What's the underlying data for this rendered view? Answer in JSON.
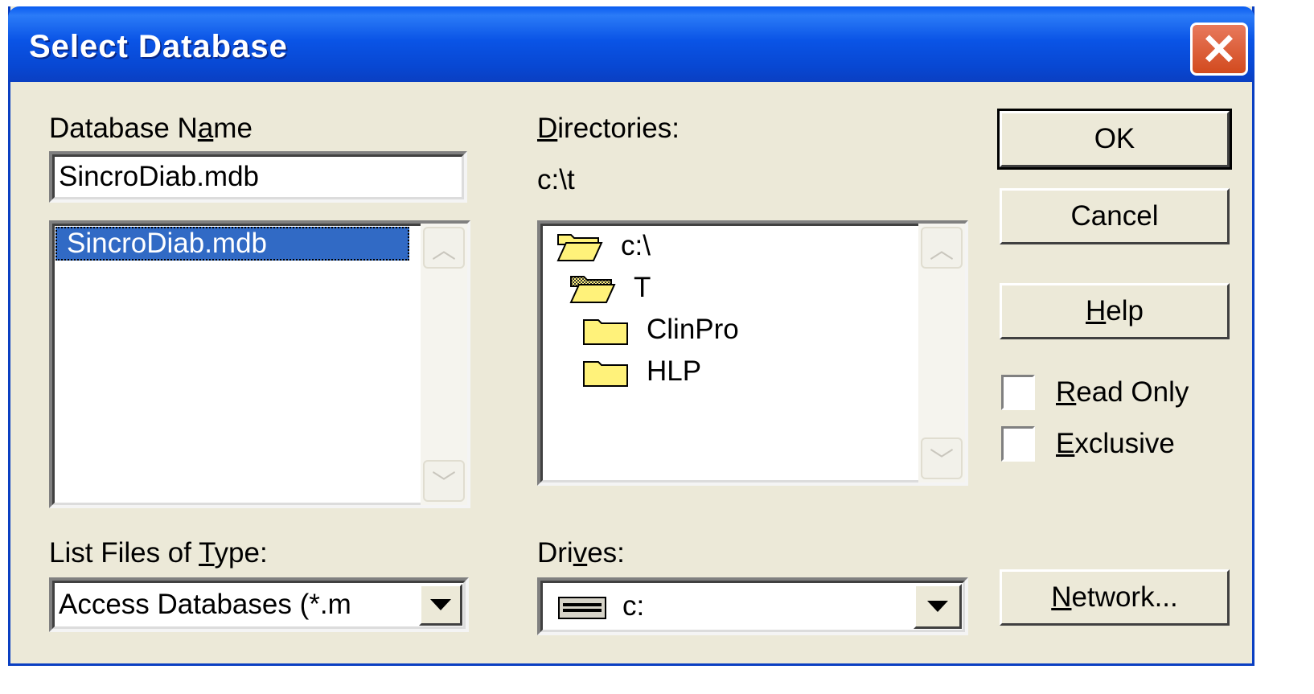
{
  "window": {
    "title": "Select Database",
    "close_glyph": "✕"
  },
  "database_name": {
    "label_pre": "Database N",
    "label_u": "a",
    "label_post": "me",
    "value": "SincroDiab.mdb",
    "files": [
      "SincroDiab.mdb"
    ]
  },
  "directories": {
    "label_u": "D",
    "label_post": "irectories:",
    "current_path": "c:\\t",
    "items": [
      {
        "name": "c:\\",
        "icon": "open-folder-icon",
        "level": 0
      },
      {
        "name": "T",
        "icon": "open-folder-selected-icon",
        "level": 1
      },
      {
        "name": "ClinPro",
        "icon": "folder-icon",
        "level": 2
      },
      {
        "name": "HLP",
        "icon": "folder-icon",
        "level": 2
      }
    ]
  },
  "file_type": {
    "label_pre": "List Files of ",
    "label_u": "T",
    "label_post": "ype:",
    "selected": "Access Databases (*.m"
  },
  "drives": {
    "label_pre": "Dri",
    "label_u": "v",
    "label_post": "es:",
    "selected": "c:"
  },
  "buttons": {
    "ok": "OK",
    "cancel": "Cancel",
    "help_u": "H",
    "help_post": "elp",
    "network_u": "N",
    "network_post": "etwork..."
  },
  "options": {
    "read_only_u": "R",
    "read_only_post": "ead Only",
    "read_only_checked": false,
    "exclusive_u": "E",
    "exclusive_post": "xclusive",
    "exclusive_checked": false
  },
  "colors": {
    "title_bar": "#0a54e6",
    "selection": "#316ac5",
    "face": "#ece9d8",
    "folder": "#fff27a"
  }
}
